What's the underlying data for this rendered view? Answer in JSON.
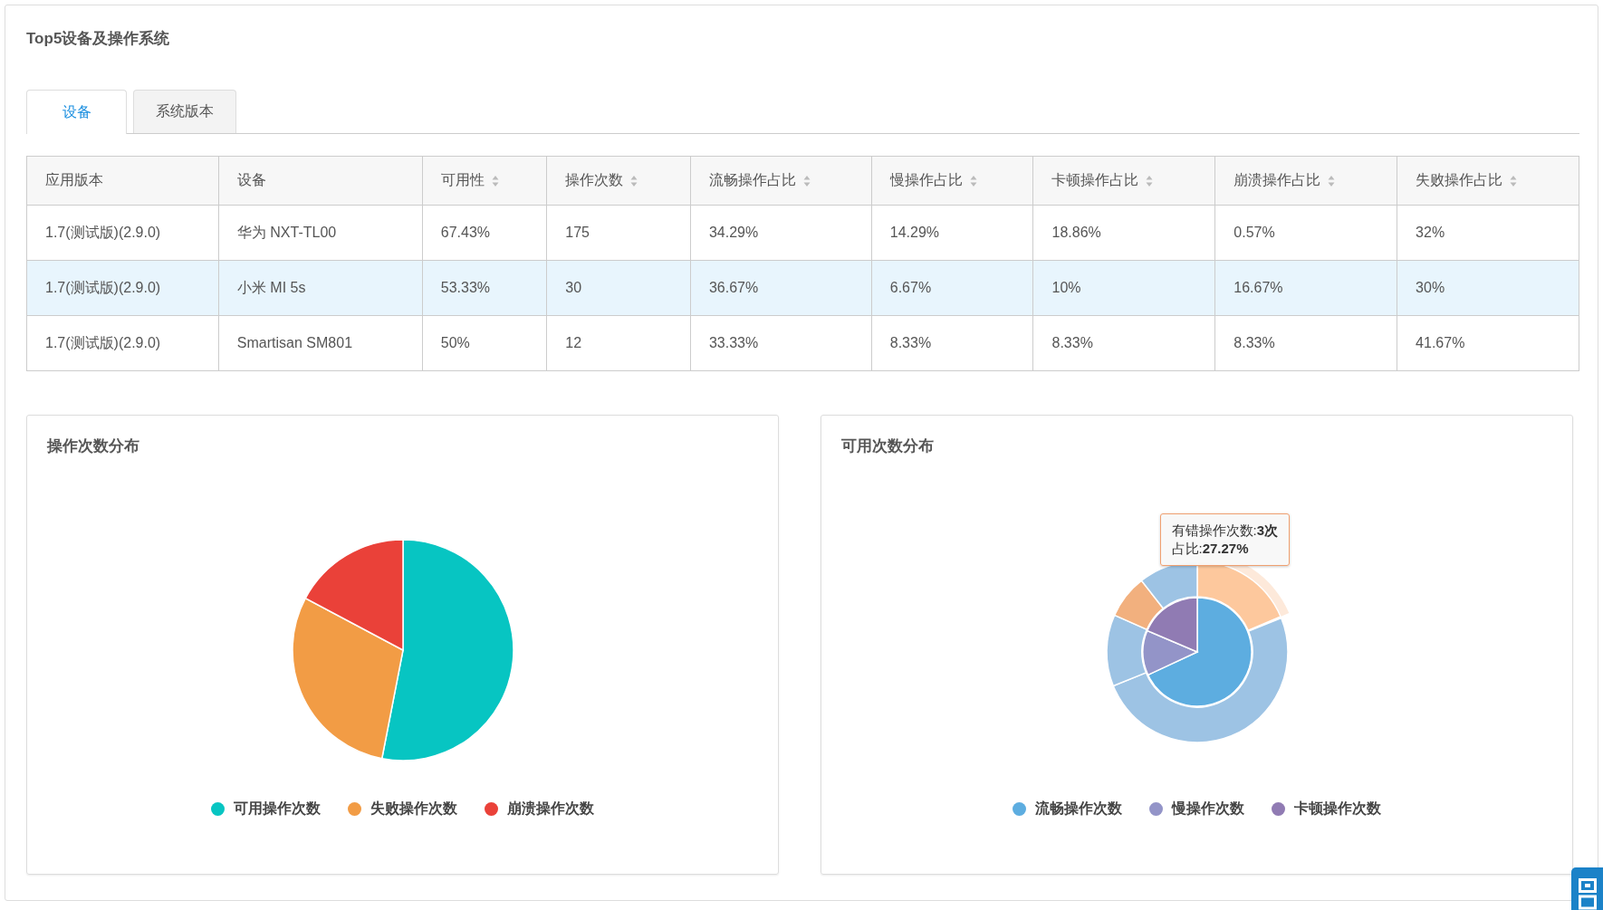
{
  "panel": {
    "title": "Top5设备及操作系统"
  },
  "tabs": [
    {
      "label": "设备",
      "selected": true
    },
    {
      "label": "系统版本",
      "selected": false
    }
  ],
  "table": {
    "columns": [
      {
        "label": "应用版本",
        "sortable": false
      },
      {
        "label": "设备",
        "sortable": false
      },
      {
        "label": "可用性",
        "sortable": true
      },
      {
        "label": "操作次数",
        "sortable": true
      },
      {
        "label": "流畅操作占比",
        "sortable": true
      },
      {
        "label": "慢操作占比",
        "sortable": true
      },
      {
        "label": "卡顿操作占比",
        "sortable": true
      },
      {
        "label": "崩溃操作占比",
        "sortable": true
      },
      {
        "label": "失败操作占比",
        "sortable": true
      }
    ],
    "rows": [
      {
        "selected": false,
        "cells": [
          "1.7(测试版)(2.9.0)",
          "华为 NXT-TL00",
          "67.43%",
          "175",
          "34.29%",
          "14.29%",
          "18.86%",
          "0.57%",
          "32%"
        ]
      },
      {
        "selected": true,
        "cells": [
          "1.7(测试版)(2.9.0)",
          "小米 MI 5s",
          "53.33%",
          "30",
          "36.67%",
          "6.67%",
          "10%",
          "16.67%",
          "30%"
        ]
      },
      {
        "selected": false,
        "cells": [
          "1.7(测试版)(2.9.0)",
          "Smartisan SM801",
          "50%",
          "12",
          "33.33%",
          "8.33%",
          "8.33%",
          "8.33%",
          "41.67%"
        ]
      }
    ]
  },
  "charts": [
    {
      "kind": "pie",
      "title": "操作次数分布",
      "legend": [
        {
          "label": "可用操作次数",
          "color": "#07c5c2"
        },
        {
          "label": "失败操作次数",
          "color": "#f29c45"
        },
        {
          "label": "崩溃操作次数",
          "color": "#ea4139"
        }
      ]
    },
    {
      "kind": "nested",
      "title": "可用次数分布",
      "tooltip": [
        "有错操作次数:**3次**",
        "占比:**27.27%**"
      ],
      "legend": [
        {
          "label": "流畅操作次数",
          "color": "#5dade0"
        },
        {
          "label": "慢操作次数",
          "color": "#9394c8"
        },
        {
          "label": "卡顿操作次数",
          "color": "#907bb3"
        }
      ]
    }
  ]
}
